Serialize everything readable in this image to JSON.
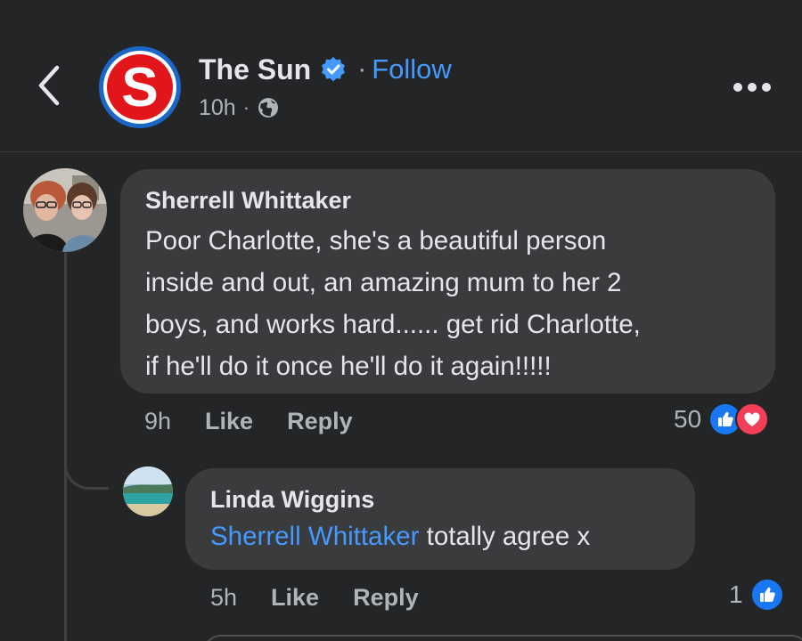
{
  "header": {
    "page_name": "The Sun",
    "follow_label": "Follow",
    "separator": "·",
    "time": "10h",
    "meta_separator": "·",
    "logo_letter": "S",
    "brand_red": "#e2151b",
    "brand_blue": "#1b66c9",
    "icons": {
      "back": "chevron-left-icon",
      "verified": "verified-badge-icon",
      "audience": "globe-icon",
      "more": "more-dots-icon"
    }
  },
  "comments": [
    {
      "author": "Sherrell Whittaker",
      "text": "Poor Charlotte, she's a beautiful person\ninside and out, an amazing mum to her 2\nboys, and works hard......  get rid Charlotte,\nif he'll do it once he'll do it again!!!!!",
      "time": "9h",
      "like_label": "Like",
      "reply_label": "Reply",
      "reaction_count": "50",
      "reactions": [
        "like",
        "love"
      ]
    },
    {
      "author": "Linda Wiggins",
      "mention": "Sherrell Whittaker",
      "text": " totally agree x",
      "time": "5h",
      "like_label": "Like",
      "reply_label": "Reply",
      "reaction_count": "1",
      "reactions": [
        "like"
      ]
    }
  ],
  "colors": {
    "background": "#242526",
    "bubble": "#3a3b3c",
    "link_blue": "#4599ff",
    "like_blue": "#1877f2",
    "love_red": "#f33e58",
    "secondary_text": "#b0b3b8",
    "primary_text": "#e4e6eb"
  }
}
